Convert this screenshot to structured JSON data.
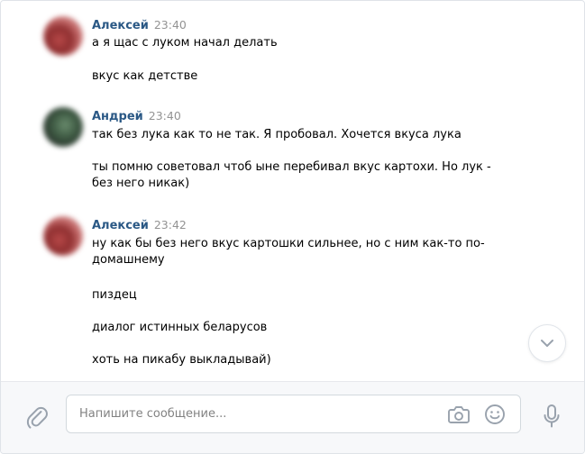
{
  "messages": [
    {
      "author": "Алексей",
      "time": "23:40",
      "avatar": "alexey",
      "lines": [
        "а я щас с луком начал делать",
        "вкус как детстве"
      ]
    },
    {
      "author": "Андрей",
      "time": "23:40",
      "avatar": "andrey",
      "lines": [
        "так без лука как то не так. Я пробовал. Хочется вкуса лука",
        "ты помню советовал чтоб ыне перебивал вкус картохи. Но лук - без него никак)"
      ]
    },
    {
      "author": "Алексей",
      "time": "23:42",
      "avatar": "alexey",
      "lines": [
        "ну как бы без него вкус картошки сильнее, но с ним как-то по-домашнему",
        "пиздец",
        "диалог истинных беларусов",
        "хоть на пикабу выкладывай)"
      ]
    }
  ],
  "composer": {
    "placeholder": "Напишите сообщение...",
    "value": ""
  },
  "icons": {
    "attach": "paperclip-icon",
    "camera": "camera-icon",
    "emoji": "smile-icon",
    "mic": "microphone-icon",
    "scroll": "chevron-down-icon"
  },
  "colors": {
    "author": "#2a5885",
    "time": "#939393",
    "icon": "#99a2ad",
    "composer_bg": "#f7f8fa"
  }
}
